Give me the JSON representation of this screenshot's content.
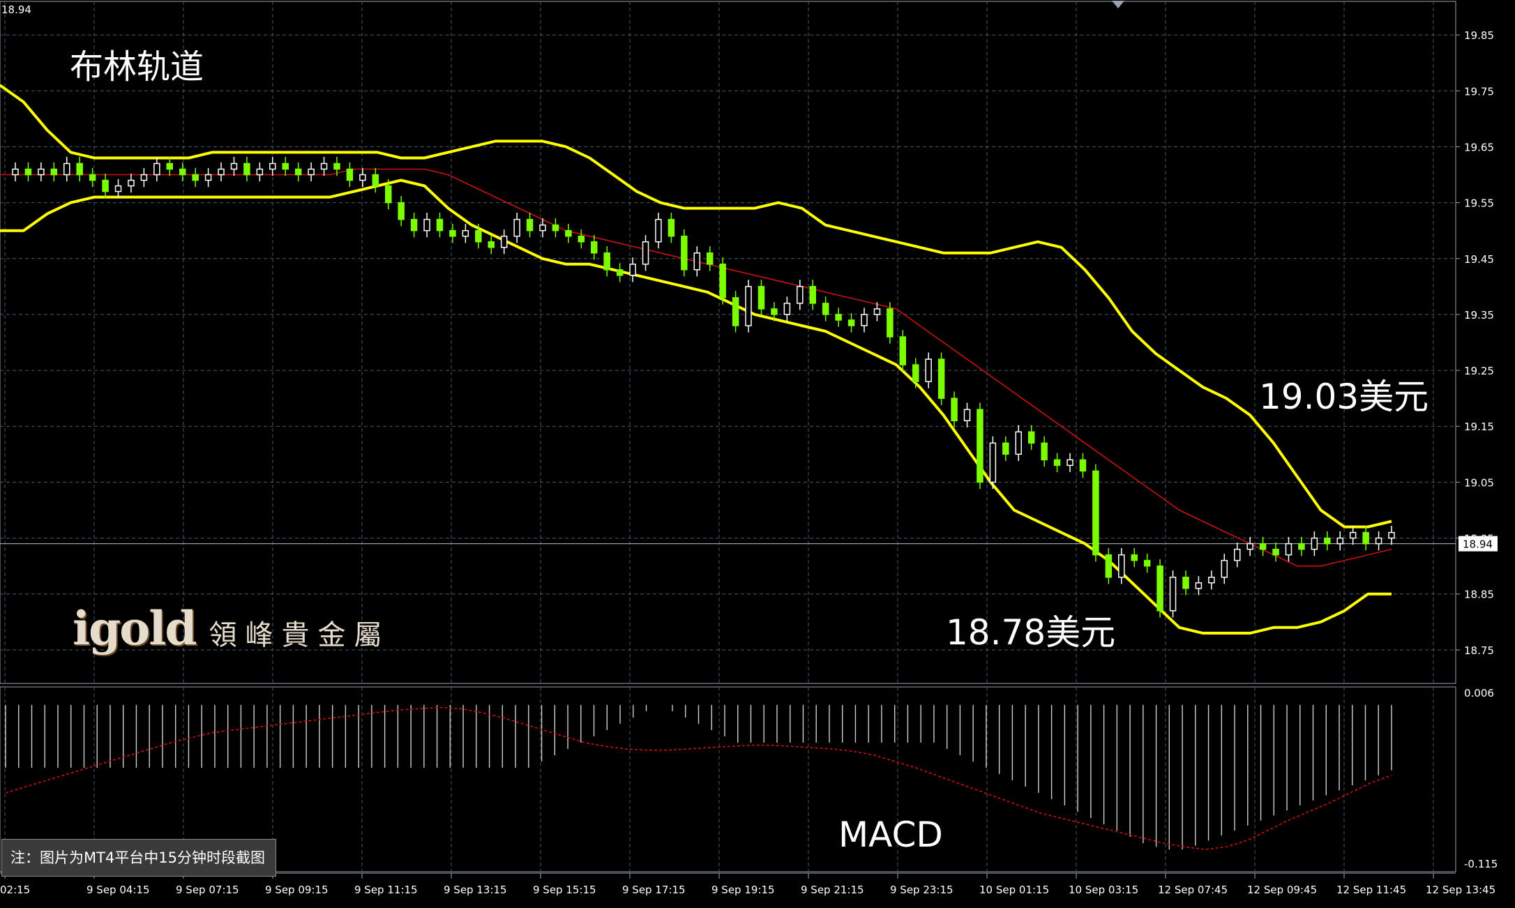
{
  "chart_data": {
    "type": "candlestick",
    "title": "布林轨道",
    "subchart_title": "MACD",
    "corner_price": "18.94",
    "current_price": 18.94,
    "current_price_label": "18.94",
    "y_range": [
      18.69,
      19.91
    ],
    "y_ticks": [
      "19.85",
      "19.75",
      "19.65",
      "19.55",
      "19.45",
      "19.35",
      "19.25",
      "19.15",
      "19.05",
      "18.95",
      "18.85",
      "18.75"
    ],
    "macd_y_ticks": [
      "0.006",
      "-0.115"
    ],
    "macd_range": [
      -0.125,
      0.006
    ],
    "x_ticks": [
      "02:15",
      "9 Sep 04:15",
      "9 Sep 07:15",
      "9 Sep 09:15",
      "9 Sep 11:15",
      "9 Sep 13:15",
      "9 Sep 15:15",
      "9 Sep 17:15",
      "9 Sep 19:15",
      "9 Sep 21:15",
      "9 Sep 23:15",
      "10 Sep 01:15",
      "10 Sep 03:15",
      "12 Sep 07:45",
      "12 Sep 09:45",
      "12 Sep 11:45",
      "12 Sep 13:45"
    ],
    "annotations": [
      {
        "text": "19.03美元",
        "price": 19.03
      },
      {
        "text": "18.78美元",
        "price": 18.78
      }
    ],
    "series": [
      {
        "name": "upper",
        "color": "#ffff00",
        "values": [
          19.76,
          19.73,
          19.68,
          19.64,
          19.63,
          19.63,
          19.63,
          19.63,
          19.63,
          19.64,
          19.64,
          19.64,
          19.64,
          19.64,
          19.64,
          19.64,
          19.64,
          19.63,
          19.63,
          19.64,
          19.65,
          19.66,
          19.66,
          19.66,
          19.65,
          19.63,
          19.6,
          19.57,
          19.55,
          19.54,
          19.54,
          19.54,
          19.54,
          19.55,
          19.54,
          19.51,
          19.5,
          19.49,
          19.48,
          19.47,
          19.46,
          19.46,
          19.46,
          19.47,
          19.48,
          19.47,
          19.43,
          19.38,
          19.32,
          19.28,
          19.25,
          19.22,
          19.2,
          19.17,
          19.12,
          19.06,
          19,
          18.97,
          18.97,
          18.98
        ]
      },
      {
        "name": "middle",
        "color": "#cc1111",
        "values": [
          19.6,
          19.6,
          19.6,
          19.6,
          19.6,
          19.6,
          19.6,
          19.6,
          19.6,
          19.6,
          19.6,
          19.6,
          19.6,
          19.6,
          19.6,
          19.61,
          19.61,
          19.61,
          19.61,
          19.6,
          19.58,
          19.56,
          19.54,
          19.52,
          19.5,
          19.49,
          19.48,
          19.47,
          19.46,
          19.45,
          19.44,
          19.43,
          19.42,
          19.41,
          19.4,
          19.39,
          19.38,
          19.37,
          19.36,
          19.33,
          19.3,
          19.27,
          19.24,
          19.21,
          19.18,
          19.15,
          19.12,
          19.09,
          19.06,
          19.03,
          19,
          18.98,
          18.96,
          18.94,
          18.92,
          18.9,
          18.9,
          18.91,
          18.92,
          18.93
        ]
      },
      {
        "name": "lower",
        "color": "#ffff00",
        "values": [
          19.5,
          19.5,
          19.53,
          19.55,
          19.56,
          19.56,
          19.56,
          19.56,
          19.56,
          19.56,
          19.56,
          19.56,
          19.56,
          19.56,
          19.56,
          19.57,
          19.58,
          19.59,
          19.58,
          19.54,
          19.51,
          19.49,
          19.47,
          19.45,
          19.44,
          19.44,
          19.43,
          19.42,
          19.41,
          19.4,
          19.39,
          19.37,
          19.35,
          19.34,
          19.33,
          19.32,
          19.3,
          19.28,
          19.26,
          19.22,
          19.17,
          19.11,
          19.05,
          19,
          18.98,
          18.96,
          18.94,
          18.91,
          18.87,
          18.83,
          18.79,
          18.78,
          18.78,
          18.78,
          18.79,
          18.79,
          18.8,
          18.82,
          18.85,
          18.85
        ]
      }
    ],
    "candles": [
      [
        19.6,
        19.61
      ],
      [
        19.61,
        19.6
      ],
      [
        19.6,
        19.61
      ],
      [
        19.61,
        19.6
      ],
      [
        19.6,
        19.62
      ],
      [
        19.62,
        19.6
      ],
      [
        19.6,
        19.59
      ],
      [
        19.59,
        19.57
      ],
      [
        19.57,
        19.58
      ],
      [
        19.58,
        19.59
      ],
      [
        19.59,
        19.6
      ],
      [
        19.6,
        19.62
      ],
      [
        19.62,
        19.61
      ],
      [
        19.61,
        19.6
      ],
      [
        19.6,
        19.59
      ],
      [
        19.59,
        19.6
      ],
      [
        19.6,
        19.61
      ],
      [
        19.61,
        19.62
      ],
      [
        19.62,
        19.6
      ],
      [
        19.6,
        19.61
      ],
      [
        19.61,
        19.62
      ],
      [
        19.62,
        19.61
      ],
      [
        19.61,
        19.6
      ],
      [
        19.6,
        19.61
      ],
      [
        19.61,
        19.62
      ],
      [
        19.62,
        19.61
      ],
      [
        19.61,
        19.59
      ],
      [
        19.59,
        19.6
      ],
      [
        19.6,
        19.58
      ],
      [
        19.58,
        19.55
      ],
      [
        19.55,
        19.52
      ],
      [
        19.52,
        19.5
      ],
      [
        19.5,
        19.52
      ],
      [
        19.52,
        19.5
      ],
      [
        19.5,
        19.49
      ],
      [
        19.49,
        19.5
      ],
      [
        19.5,
        19.48
      ],
      [
        19.48,
        19.47
      ],
      [
        19.47,
        19.49
      ],
      [
        19.49,
        19.52
      ],
      [
        19.52,
        19.5
      ],
      [
        19.5,
        19.51
      ],
      [
        19.51,
        19.5
      ],
      [
        19.5,
        19.49
      ],
      [
        19.49,
        19.48
      ],
      [
        19.48,
        19.46
      ],
      [
        19.46,
        19.43
      ],
      [
        19.43,
        19.42
      ],
      [
        19.42,
        19.44
      ],
      [
        19.44,
        19.48
      ],
      [
        19.48,
        19.52
      ],
      [
        19.52,
        19.49
      ],
      [
        19.49,
        19.43
      ],
      [
        19.43,
        19.46
      ],
      [
        19.46,
        19.44
      ],
      [
        19.44,
        19.38
      ],
      [
        19.38,
        19.33
      ],
      [
        19.33,
        19.4
      ],
      [
        19.4,
        19.36
      ],
      [
        19.36,
        19.35
      ],
      [
        19.35,
        19.37
      ],
      [
        19.37,
        19.4
      ],
      [
        19.4,
        19.37
      ],
      [
        19.37,
        19.35
      ],
      [
        19.35,
        19.34
      ],
      [
        19.34,
        19.33
      ],
      [
        19.33,
        19.35
      ],
      [
        19.35,
        19.36
      ],
      [
        19.36,
        19.31
      ],
      [
        19.31,
        19.26
      ],
      [
        19.26,
        19.23
      ],
      [
        19.23,
        19.27
      ],
      [
        19.27,
        19.2
      ],
      [
        19.2,
        19.16
      ],
      [
        19.16,
        19.18
      ],
      [
        19.18,
        19.05
      ],
      [
        19.05,
        19.12
      ],
      [
        19.12,
        19.1
      ],
      [
        19.1,
        19.14
      ],
      [
        19.14,
        19.12
      ],
      [
        19.12,
        19.09
      ],
      [
        19.09,
        19.08
      ],
      [
        19.08,
        19.09
      ],
      [
        19.09,
        19.07
      ],
      [
        19.07,
        18.92
      ],
      [
        18.92,
        18.88
      ],
      [
        18.88,
        18.92
      ],
      [
        18.92,
        18.91
      ],
      [
        18.91,
        18.9
      ],
      [
        18.9,
        18.82
      ],
      [
        18.82,
        18.88
      ],
      [
        18.88,
        18.86
      ],
      [
        18.86,
        18.87
      ],
      [
        18.87,
        18.88
      ],
      [
        18.88,
        18.91
      ],
      [
        18.91,
        18.93
      ],
      [
        18.93,
        18.94
      ],
      [
        18.94,
        18.93
      ],
      [
        18.93,
        18.92
      ],
      [
        18.92,
        18.94
      ],
      [
        18.94,
        18.93
      ],
      [
        18.93,
        18.95
      ],
      [
        18.95,
        18.94
      ],
      [
        18.94,
        18.95
      ],
      [
        18.95,
        18.96
      ],
      [
        18.96,
        18.94
      ],
      [
        18.94,
        18.95
      ],
      [
        18.95,
        18.96
      ]
    ],
    "macd_hist": [
      -0.05,
      -0.05,
      -0.05,
      -0.05,
      -0.05,
      -0.05,
      -0.05,
      -0.05,
      -0.05,
      -0.05,
      -0.05,
      -0.05,
      -0.05,
      -0.05,
      -0.05,
      -0.05,
      -0.05,
      -0.05,
      -0.05,
      -0.05,
      -0.05,
      -0.05,
      -0.05,
      -0.05,
      -0.05,
      -0.05,
      -0.05,
      -0.05,
      -0.05,
      -0.05,
      -0.05,
      -0.05,
      -0.05,
      -0.05,
      -0.05,
      -0.05,
      -0.05,
      -0.05,
      -0.05,
      -0.05,
      -0.05,
      -0.045,
      -0.04,
      -0.035,
      -0.03,
      -0.025,
      -0.02,
      -0.015,
      -0.01,
      -0.005,
      0.0,
      -0.005,
      -0.01,
      -0.015,
      -0.02,
      -0.025,
      -0.03,
      -0.03,
      -0.03,
      -0.03,
      -0.03,
      -0.03,
      -0.03,
      -0.03,
      -0.03,
      -0.03,
      -0.03,
      -0.03,
      -0.03,
      -0.03,
      -0.03,
      -0.03,
      -0.035,
      -0.04,
      -0.045,
      -0.05,
      -0.055,
      -0.06,
      -0.065,
      -0.07,
      -0.075,
      -0.08,
      -0.085,
      -0.09,
      -0.095,
      -0.1,
      -0.105,
      -0.11,
      -0.113,
      -0.115,
      -0.115,
      -0.112,
      -0.108,
      -0.104,
      -0.1,
      -0.096,
      -0.092,
      -0.088,
      -0.084,
      -0.08,
      -0.076,
      -0.072,
      -0.068,
      -0.064,
      -0.06,
      -0.056,
      -0.052
    ],
    "macd_signal": [
      -0.07,
      -0.065,
      -0.06,
      -0.055,
      -0.05,
      -0.045,
      -0.04,
      -0.035,
      -0.03,
      -0.026,
      -0.022,
      -0.02,
      -0.018,
      -0.016,
      -0.014,
      -0.012,
      -0.01,
      -0.008,
      -0.006,
      -0.004,
      -0.003,
      -0.002,
      -0.003,
      -0.006,
      -0.01,
      -0.015,
      -0.02,
      -0.025,
      -0.03,
      -0.033,
      -0.035,
      -0.036,
      -0.036,
      -0.035,
      -0.034,
      -0.033,
      -0.032,
      -0.032,
      -0.033,
      -0.034,
      -0.035,
      -0.037,
      -0.04,
      -0.045,
      -0.05,
      -0.056,
      -0.062,
      -0.068,
      -0.074,
      -0.08,
      -0.086,
      -0.09,
      -0.094,
      -0.098,
      -0.102,
      -0.106,
      -0.11,
      -0.113,
      -0.115,
      -0.113,
      -0.108,
      -0.1,
      -0.092,
      -0.085,
      -0.078,
      -0.07,
      -0.062,
      -0.056
    ]
  },
  "note": "注：图片为MT4平台中15分钟时段截图",
  "logo": {
    "brand": "igold",
    "name": "領峰貴金屬"
  },
  "colors": {
    "background": "#000000",
    "grid": "#4a5a6a",
    "band": "#ffff00",
    "middle": "#cc1111",
    "bull": "#ffffff",
    "bear": "#7cfc00",
    "macd_hist": "#cfcfcf",
    "macd_signal": "#cc1111"
  }
}
